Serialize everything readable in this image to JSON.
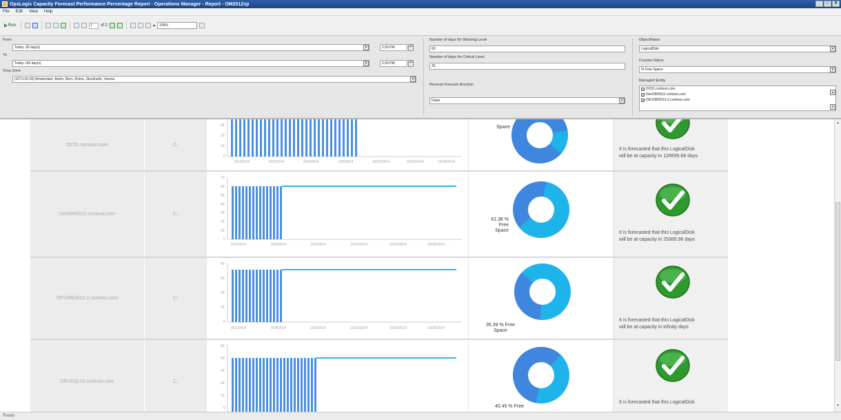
{
  "window": {
    "title": "OpsLogix Capacity Forecast Performance Percentage Report - Operations Manager - Report - OM2012sp",
    "controls": [
      "_",
      "□",
      "X"
    ]
  },
  "menu": [
    "File",
    "Edit",
    "View",
    "Help"
  ],
  "toolbar": {
    "run_label": "Run",
    "page_current": "1",
    "page_total": "of 2",
    "zoom": "100%"
  },
  "params": {
    "from_label": "From",
    "from_value": "Today -30 day(s)",
    "from_time": "2:30 PM",
    "to_label": "To",
    "to_value": "Today +30 day(s)",
    "to_time": "2:30 PM",
    "timezone_label": "Time Zone",
    "timezone_value": "(UTC+01:00) Amsterdam, Berlin, Bern, Rome, Stockholm, Vienna",
    "warning_label": "Number of days for Warning Level",
    "warning_value": "60",
    "critical_label": "Number of days for Critical Level",
    "critical_value": "30",
    "reverse_label": "Reverse forecast direction",
    "reverse_value": "False",
    "object_label": "ObjectName",
    "object_value": "LogicalDisk",
    "counter_label": "Counter Name",
    "counter_value": "% Free Space",
    "entities_label": "Managed Entity",
    "entities": [
      "DC01.contoso.com",
      "DevOM2012.contoso.com",
      "DEVOM2012-2.contoso.com"
    ]
  },
  "rows": [
    {
      "server": "DC01.contoso.com",
      "drive": "C:",
      "pie_text": "Space",
      "free_fraction": 0.14,
      "forecast_line1": "It is forecasted that this LogicalDisk",
      "forecast_line2": "will be at capacity in 126695.68 days",
      "chart_ticks_y": [
        "30",
        "20",
        "10",
        "0"
      ],
      "chart_ticks_x": [
        "9/14/2014",
        "9/21/2014",
        "9/28/2014",
        "10/5/2014",
        "10/12/2014",
        "10/19/2014",
        "10/26/2014"
      ]
    },
    {
      "server": "DevOM2012.contoso.com",
      "drive": "C:",
      "pie_text": "61.38 %\nFree\nSpace",
      "free_fraction": 0.6138,
      "forecast_line1": "It is forecasted that this LogicalDisk",
      "forecast_line2": "will be at capacity in 25389.96 days",
      "chart_ticks_y": [
        "70",
        "60",
        "50",
        "40",
        "30",
        "20",
        "10",
        "0"
      ],
      "chart_ticks_x": [
        "9/21/2014",
        "9/28/2014",
        "10/5/2014",
        "10/12/2014",
        "10/19/2014",
        "10/26/2014"
      ]
    },
    {
      "server": "DEVOM2012-2.contoso.com",
      "drive": "C:",
      "pie_text": "35.39 % Free\nSpace",
      "free_fraction": 0.3539,
      "forecast_line1": "It is forecasted that this LogicalDisk",
      "forecast_line2": "will be at capacity in infinity days",
      "chart_ticks_y": [
        "40",
        "30",
        "20",
        "10",
        "0"
      ],
      "chart_ticks_x": [
        "9/21/2014",
        "9/28/2014",
        "10/5/2014",
        "10/12/2014",
        "10/19/2014",
        "10/26/2014"
      ]
    },
    {
      "server": "DEVSQL01.contoso.com",
      "drive": "C:",
      "pie_text": "40.45 % Free",
      "free_fraction": 0.4045,
      "forecast_line1": "It is forecasted that this LogicalDisk",
      "forecast_line2": "",
      "chart_ticks_y": [
        "50",
        "40",
        "30",
        "20",
        "10",
        "0"
      ],
      "chart_ticks_x": []
    }
  ],
  "status_bar": "Ready",
  "colors": {
    "bar": "#4a90e2",
    "forecast_line": "#29b6e8",
    "donut_free": "#1eb4ea",
    "donut_used": "#3f86de",
    "check_green": "#2e9a2e"
  }
}
